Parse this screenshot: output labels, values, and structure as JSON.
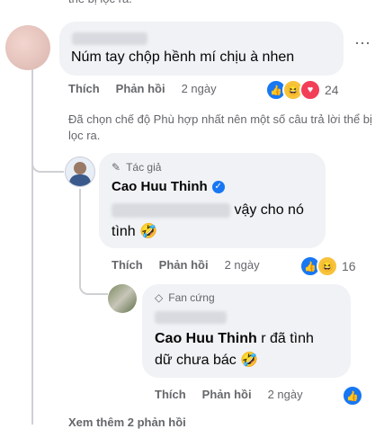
{
  "top_note_fragment": "thể bị lọc ra.",
  "comment1": {
    "text": "Núm tay chộp hềnh mí chịu à nhen",
    "like": "Thích",
    "reply": "Phản hồi",
    "time": "2 ngày",
    "reaction_count": "24",
    "more_icon": "⋯"
  },
  "filter_note": "Đã chọn chế độ Phù hợp nhất nên một số câu trả lời thể bị lọc ra.",
  "reply1": {
    "badge": "Tác giả",
    "name": "Cao Huu Thinh",
    "text_visible": "vậy cho nó",
    "text_line2": "tình",
    "emoji": "🤣",
    "like": "Thích",
    "reply": "Phản hồi",
    "time": "2 ngày",
    "reaction_count": "16"
  },
  "reply2": {
    "badge": "Fan cứng",
    "mention": "Cao Huu Thinh",
    "text_after_mention": " r đã tình",
    "text_line2": "dữ chưa bác",
    "emoji": "🤣",
    "like": "Thích",
    "reply": "Phản hồi",
    "time": "2 ngày"
  },
  "bottom_fragment": "Xem thêm 2 phản hồi"
}
